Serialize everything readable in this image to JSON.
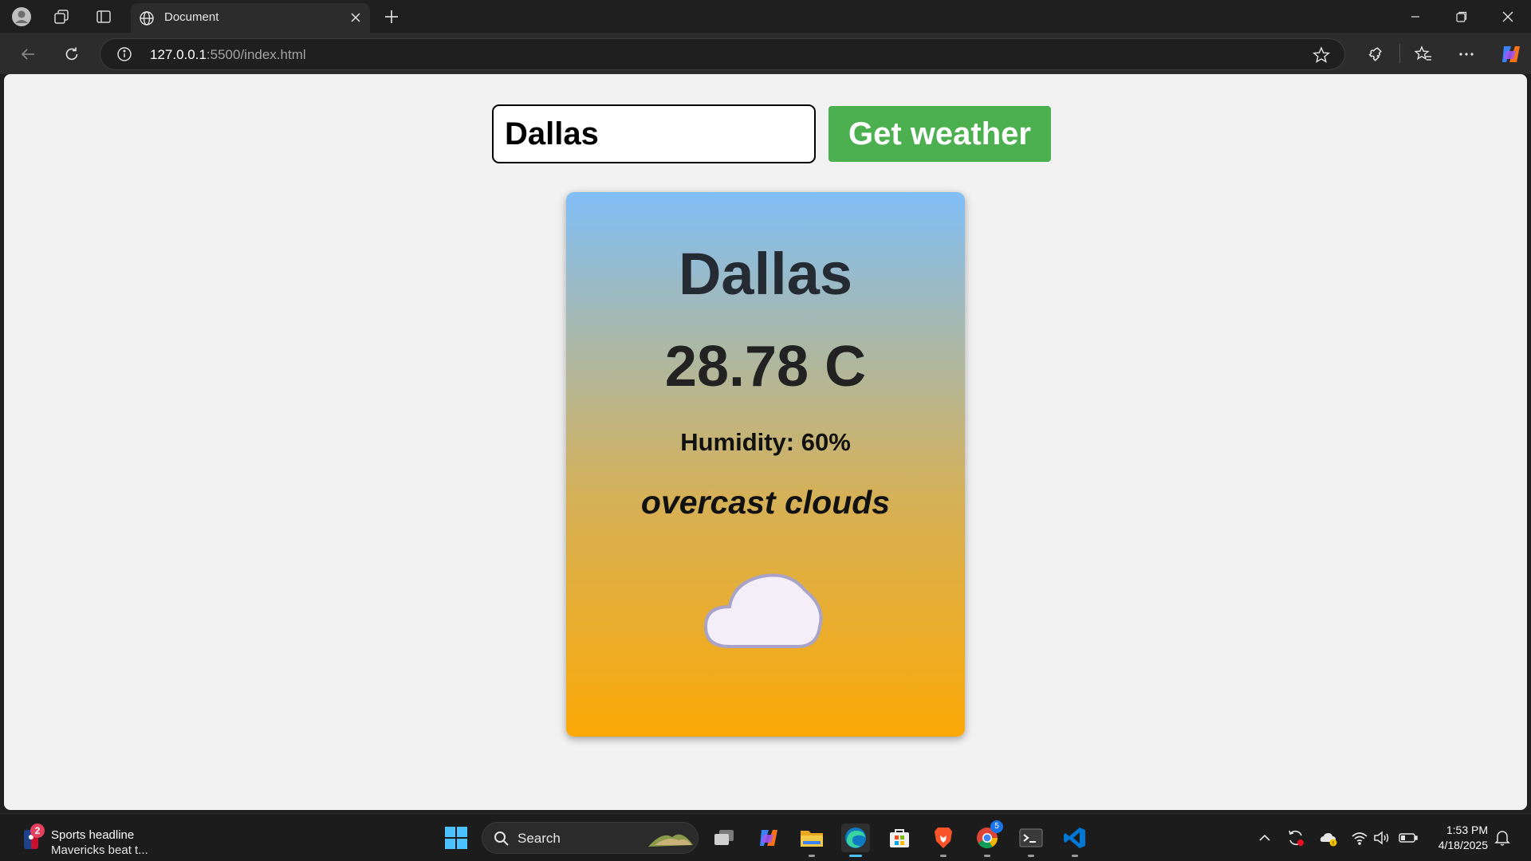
{
  "browser": {
    "tab_title": "Document",
    "url_host": "127.0.0.1",
    "url_rest": ":5500/index.html",
    "icons": [
      "profile-icon",
      "workspaces-icon",
      "tab-actions-icon",
      "globe-icon",
      "close-icon",
      "new-tab-icon",
      "minimize-icon",
      "restore-icon",
      "window-close-icon",
      "back-icon",
      "refresh-icon",
      "site-info-icon",
      "favorite-star-icon",
      "extensions-icon",
      "favorites-icon",
      "more-icon",
      "copilot-icon"
    ]
  },
  "page": {
    "search_value": "Dallas",
    "button_label": "Get weather",
    "card": {
      "city": "Dallas",
      "temperature": "28.78 C",
      "humidity": "Humidity: 60%",
      "description": "overcast clouds",
      "icon": "cloud-icon"
    },
    "colors": {
      "button": "#4caf50",
      "card_top": "#80bff7",
      "card_bottom": "#fba906"
    }
  },
  "taskbar": {
    "news_badge": "2",
    "news_title": "Sports headline",
    "news_subtitle": "Mavericks beat t...",
    "search_label": "Search",
    "chrome_badge": "5",
    "time": "1:53 PM",
    "date": "4/18/2025"
  }
}
